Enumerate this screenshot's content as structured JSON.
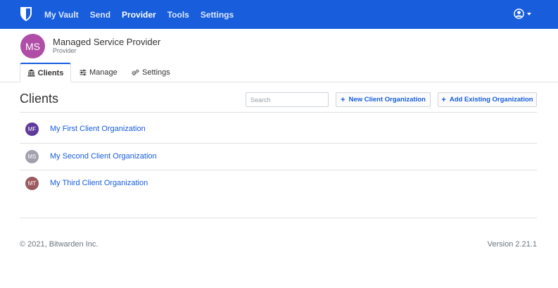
{
  "navbar": {
    "links": [
      {
        "label": "My Vault",
        "active": false
      },
      {
        "label": "Send",
        "active": false
      },
      {
        "label": "Provider",
        "active": true
      },
      {
        "label": "Tools",
        "active": false
      },
      {
        "label": "Settings",
        "active": false
      }
    ],
    "brand_icon": "bitwarden-shield-icon",
    "account_icon": "user-circle-icon"
  },
  "provider": {
    "initials": "MS",
    "name": "Managed Service Provider",
    "subtitle": "Provider",
    "avatar_color": "#b04ea7"
  },
  "tabs": [
    {
      "label": "Clients",
      "icon": "bank-icon",
      "active": true
    },
    {
      "label": "Manage",
      "icon": "sliders-icon",
      "active": false
    },
    {
      "label": "Settings",
      "icon": "cogs-icon",
      "active": false
    }
  ],
  "main": {
    "title": "Clients",
    "search_placeholder": "Search",
    "new_client_label": "New Client Organization",
    "add_existing_label": "Add Existing Organization"
  },
  "clients": [
    {
      "initials": "MF",
      "name": "My First Client Organization",
      "color": "#5d3a9b"
    },
    {
      "initials": "MS",
      "name": "My Second Client Organization",
      "color": "#a3a0ad"
    },
    {
      "initials": "MT",
      "name": "My Third Client Organization",
      "color": "#9b5a5e"
    }
  ],
  "footer": {
    "copyright": "© 2021, Bitwarden Inc.",
    "version": "Version 2.21.1"
  },
  "colors": {
    "primary": "#175ddc",
    "border": "#dee2e6",
    "muted": "#6c757d"
  }
}
